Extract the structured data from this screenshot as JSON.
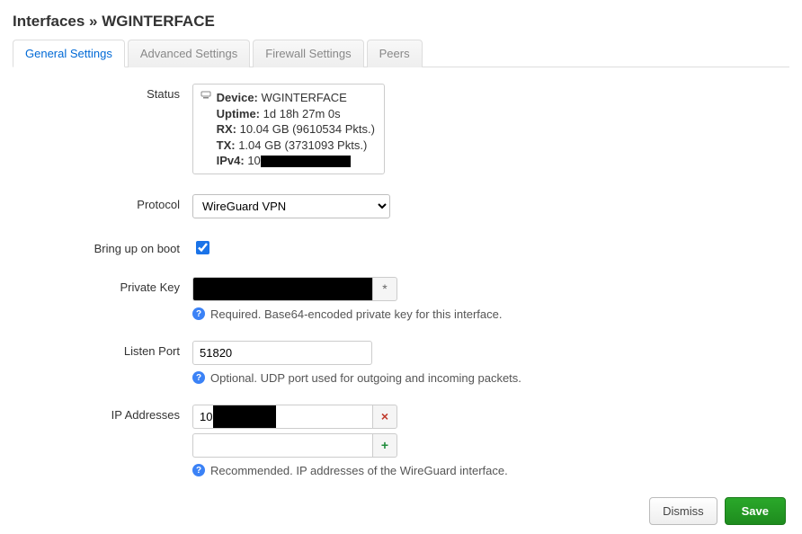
{
  "title": "Interfaces » WGINTERFACE",
  "tabs": [
    {
      "label": "General Settings",
      "active": true
    },
    {
      "label": "Advanced Settings",
      "active": false
    },
    {
      "label": "Firewall Settings",
      "active": false
    },
    {
      "label": "Peers",
      "active": false
    }
  ],
  "labels": {
    "status": "Status",
    "protocol": "Protocol",
    "boot": "Bring up on boot",
    "private_key": "Private Key",
    "listen_port": "Listen Port",
    "ip_addresses": "IP Addresses"
  },
  "status": {
    "device_label": "Device:",
    "device_value": "WGINTERFACE",
    "uptime_label": "Uptime:",
    "uptime_value": "1d 18h 27m 0s",
    "rx_label": "RX:",
    "rx_value": "10.04 GB (9610534 Pkts.)",
    "tx_label": "TX:",
    "tx_value": "1.04 GB (3731093 Pkts.)",
    "ipv4_label": "IPv4:",
    "ipv4_value": "10"
  },
  "protocol": {
    "selected": "WireGuard VPN"
  },
  "boot_checked": true,
  "private_key": {
    "value": "████████████████████",
    "reveal_glyph": "*",
    "help": "Required. Base64-encoded private key for this interface."
  },
  "listen_port": {
    "value": "51820",
    "help": "Optional. UDP port used for outgoing and incoming packets."
  },
  "ip_addresses": {
    "values": [
      "10"
    ],
    "help": "Recommended. IP addresses of the WireGuard interface.",
    "del_glyph": "×",
    "add_glyph": "+"
  },
  "footer": {
    "dismiss": "Dismiss",
    "save": "Save"
  }
}
